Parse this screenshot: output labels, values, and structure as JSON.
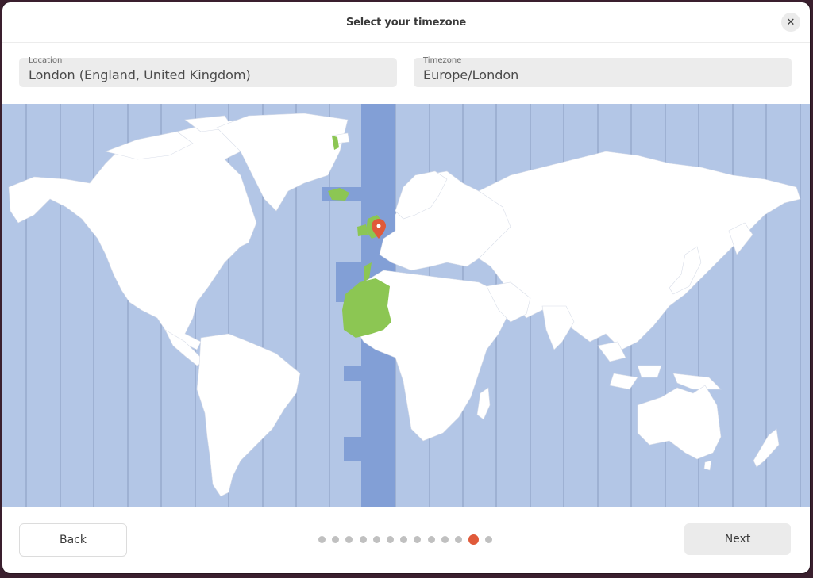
{
  "window": {
    "title": "Select your timezone",
    "close_icon": "close-icon"
  },
  "location": {
    "label": "Location",
    "value": "London (England, United Kingdom)"
  },
  "timezone": {
    "label": "Timezone",
    "value": "Europe/London"
  },
  "map": {
    "selected_zone": "Europe/London",
    "pin_icon": "map-pin-icon",
    "colors": {
      "ocean": "#b3c6e6",
      "land": "#ffffff",
      "selected_band": "#829fd6",
      "selected_land": "#8cc653",
      "pin": "#e05a3a",
      "zone_line": "#8a9cc0"
    }
  },
  "footer": {
    "back_label": "Back",
    "next_label": "Next",
    "steps_total": 13,
    "current_step": 12
  },
  "colors": {
    "accent": "#e05a3a"
  }
}
